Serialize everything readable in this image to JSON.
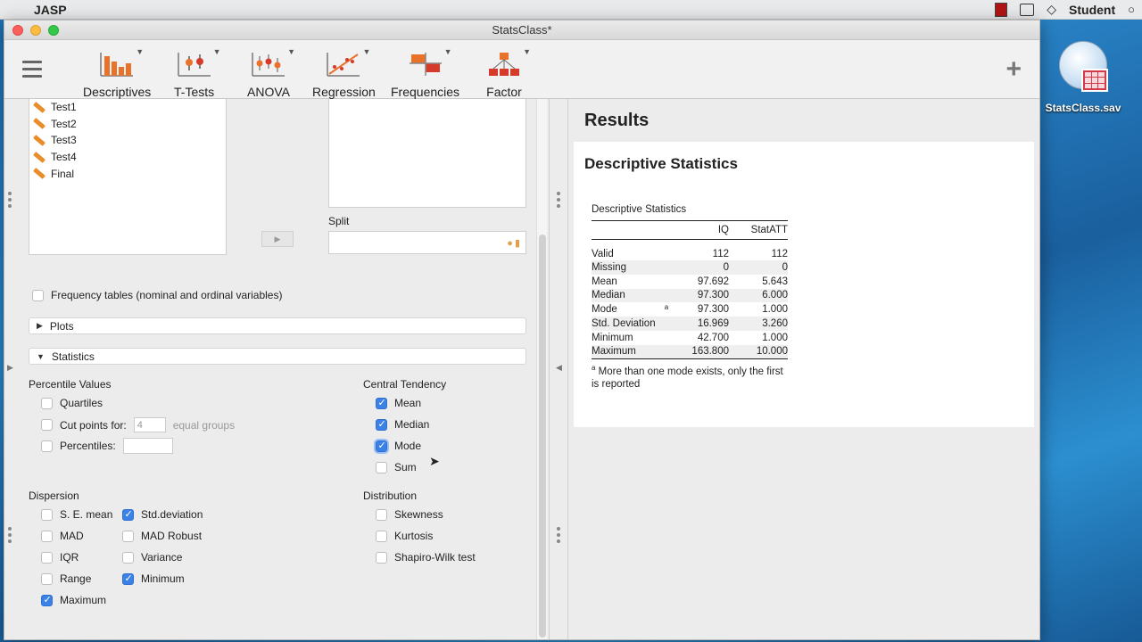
{
  "menubar": {
    "app_name": "JASP",
    "user": "Student"
  },
  "window": {
    "title": "StatsClass*"
  },
  "toolbar": {
    "items": [
      "Descriptives",
      "T-Tests",
      "ANOVA",
      "Regression",
      "Frequencies",
      "Factor"
    ]
  },
  "variables": [
    "Test1",
    "Test2",
    "Test3",
    "Test4",
    "Final"
  ],
  "split_label": "Split",
  "frequency_tables_label": "Frequency tables (nominal and ordinal variables)",
  "sections": {
    "plots": "Plots",
    "statistics": "Statistics"
  },
  "percentile": {
    "title": "Percentile Values",
    "quartiles": "Quartiles",
    "cut_points": "Cut points for:",
    "cut_points_value": "4",
    "equal_groups": "equal groups",
    "percentiles": "Percentiles:"
  },
  "central": {
    "title": "Central Tendency",
    "mean": "Mean",
    "median": "Median",
    "mode": "Mode",
    "sum": "Sum"
  },
  "dispersion": {
    "title": "Dispersion",
    "se_mean": "S. E. mean",
    "std": "Std.deviation",
    "mad": "MAD",
    "mad_robust": "MAD Robust",
    "iqr": "IQR",
    "variance": "Variance",
    "range": "Range",
    "minimum": "Minimum",
    "maximum": "Maximum"
  },
  "distribution": {
    "title": "Distribution",
    "skewness": "Skewness",
    "kurtosis": "Kurtosis",
    "shapiro": "Shapiro-Wilk test"
  },
  "results": {
    "title": "Results",
    "heading": "Descriptive Statistics",
    "table_caption": "Descriptive Statistics",
    "columns": [
      "IQ",
      "StatATT"
    ],
    "rows": [
      {
        "label": "Valid",
        "iq": "112",
        "att": "112"
      },
      {
        "label": "Missing",
        "iq": "0",
        "att": "0"
      },
      {
        "label": "Mean",
        "iq": "97.692",
        "att": "5.643"
      },
      {
        "label": "Median",
        "iq": "97.300",
        "att": "6.000"
      },
      {
        "label": "Mode",
        "sup": "a",
        "iq": "97.300",
        "att": "1.000"
      },
      {
        "label": "Std. Deviation",
        "iq": "16.969",
        "att": "3.260"
      },
      {
        "label": "Minimum",
        "iq": "42.700",
        "att": "1.000"
      },
      {
        "label": "Maximum",
        "iq": "163.800",
        "att": "10.000"
      }
    ],
    "footnote_mark": "a",
    "footnote": "More than one mode exists, only the first is reported"
  },
  "desktop": {
    "file": "StatsClass.sav"
  }
}
